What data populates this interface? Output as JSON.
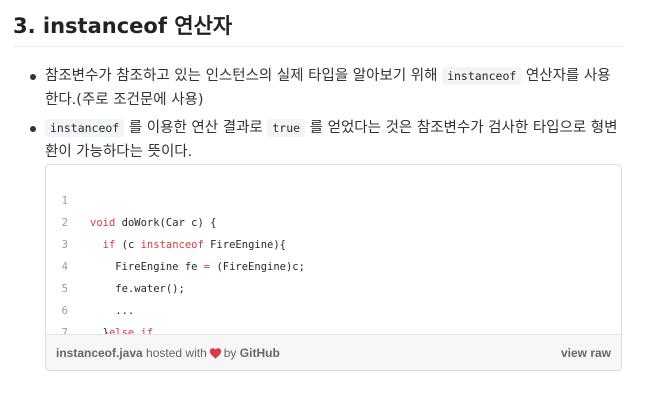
{
  "heading": "3. instanceof 연산자",
  "bullets": [
    {
      "text_before": "참조변수가 참조하고 있는 인스턴스의 실제 타입을 알아보기 위해 ",
      "code": "instanceof",
      "text_after": " 연산자를 사용한다.(주로 조건문에 사용)"
    },
    {
      "code1": "instanceof",
      "text_mid": " 를 이용한 연산 결과로 ",
      "code2": "true",
      "text_after": " 를 얻었다는 것은 참조변수가 검사한 타입으로 형변환이 가능하다는 뜻이다."
    }
  ],
  "gist": {
    "lines": [
      {
        "num": "1",
        "pre": "",
        "kw1": "void",
        "mid": " doWork(Car c) {",
        "kw2": "",
        "post": ""
      },
      {
        "num": "2",
        "pre": "  ",
        "kw1": "if",
        "mid": " (c ",
        "kw2": "instanceof",
        "post": " FireEngine){"
      },
      {
        "num": "3",
        "pre": "    FireEngine fe ",
        "kw1": "=",
        "mid": " (FireEngine)c;",
        "kw2": "",
        "post": ""
      },
      {
        "num": "4",
        "pre": "    fe.water();",
        "kw1": "",
        "mid": "",
        "kw2": "",
        "post": ""
      },
      {
        "num": "5",
        "pre": "    ...",
        "kw1": "",
        "mid": "",
        "kw2": "",
        "post": ""
      },
      {
        "num": "6",
        "pre": "  }",
        "kw1": "else",
        "mid": " ",
        "kw2": "if",
        "post": " ..."
      },
      {
        "num": "7",
        "pre": "}",
        "kw1": "",
        "mid": "",
        "kw2": "",
        "post": ""
      }
    ],
    "meta": {
      "filename": "instanceof.java",
      "hosted_with": "hosted with",
      "heart_icon": "heart-icon",
      "heart_color": "#d73a49",
      "by": "by",
      "provider": "GitHub",
      "view_raw": "view raw"
    }
  }
}
